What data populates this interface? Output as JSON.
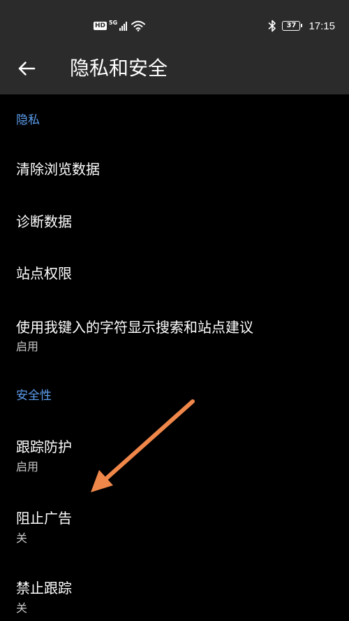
{
  "status_bar": {
    "hd": "HD",
    "network": "5G",
    "battery": "37",
    "time": "17:15"
  },
  "header": {
    "title": "隐私和安全"
  },
  "sections": {
    "privacy": {
      "label": "隐私",
      "items": [
        {
          "title": "清除浏览数据"
        },
        {
          "title": "诊断数据"
        },
        {
          "title": "站点权限"
        },
        {
          "title": "使用我键入的字符显示搜索和站点建议",
          "subtitle": "启用"
        }
      ]
    },
    "security": {
      "label": "安全性",
      "items": [
        {
          "title": "跟踪防护",
          "subtitle": "启用"
        },
        {
          "title": "阻止广告",
          "subtitle": "关"
        },
        {
          "title": "禁止跟踪",
          "subtitle": "关"
        }
      ]
    }
  },
  "colors": {
    "background": "#000000",
    "bars": "#2b2b2b",
    "accent": "#5c9ded",
    "annotation_arrow": "#f0874a"
  },
  "icons": {
    "back": "arrow-left-icon",
    "bluetooth": "bluetooth-icon",
    "wifi": "wifi-icon",
    "signal": "cell-signal-icon",
    "battery": "battery-icon"
  }
}
